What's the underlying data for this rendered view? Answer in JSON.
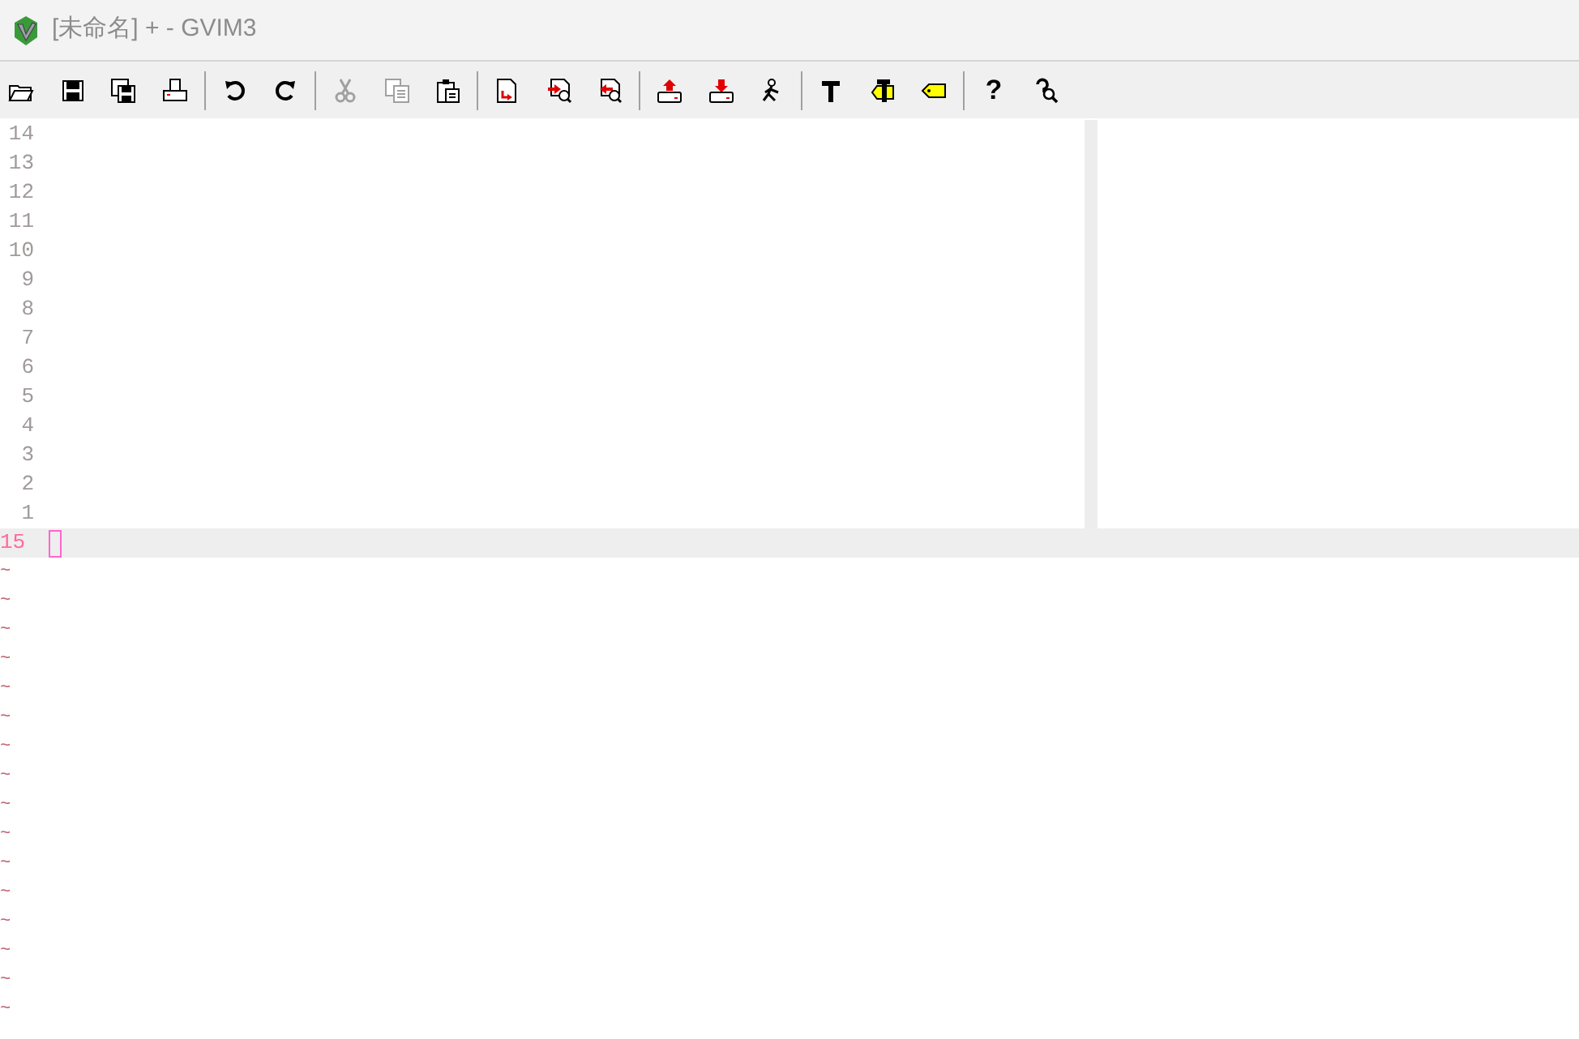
{
  "window": {
    "title": "[未命名] + - GVIM3",
    "active": false
  },
  "toolbar": [
    [
      {
        "kind": "open",
        "disabled": false
      },
      {
        "kind": "save",
        "disabled": false
      },
      {
        "kind": "save_all",
        "disabled": false
      },
      {
        "kind": "print",
        "disabled": false
      }
    ],
    [
      {
        "kind": "undo",
        "disabled": false
      },
      {
        "kind": "redo",
        "disabled": false
      }
    ],
    [
      {
        "kind": "cut",
        "disabled": true
      },
      {
        "kind": "copy",
        "disabled": true
      },
      {
        "kind": "paste",
        "disabled": false
      }
    ],
    [
      {
        "kind": "replace",
        "disabled": false
      },
      {
        "kind": "find_next",
        "disabled": false
      },
      {
        "kind": "find_prev",
        "disabled": false
      }
    ],
    [
      {
        "kind": "load_session",
        "disabled": false
      },
      {
        "kind": "save_session",
        "disabled": false
      },
      {
        "kind": "run_script",
        "disabled": false
      }
    ],
    [
      {
        "kind": "make",
        "disabled": false
      },
      {
        "kind": "build_tags",
        "disabled": false
      },
      {
        "kind": "jump_tag",
        "disabled": false
      }
    ],
    [
      {
        "kind": "help",
        "glyph": "?",
        "disabled": false
      },
      {
        "kind": "find_help",
        "disabled": false
      }
    ]
  ],
  "editor": {
    "lines_above": [
      "14",
      "13",
      "12",
      "11",
      "10",
      "9",
      "8",
      "7",
      "6",
      "5",
      "4",
      "3",
      "2",
      "1"
    ],
    "current_line": {
      "number": "15"
    },
    "empty_markers": [
      "~",
      "~",
      "~",
      "~",
      "~",
      "~",
      "~",
      "~",
      "~",
      "~",
      "~",
      "~",
      "~",
      "~",
      "~",
      "~"
    ]
  }
}
